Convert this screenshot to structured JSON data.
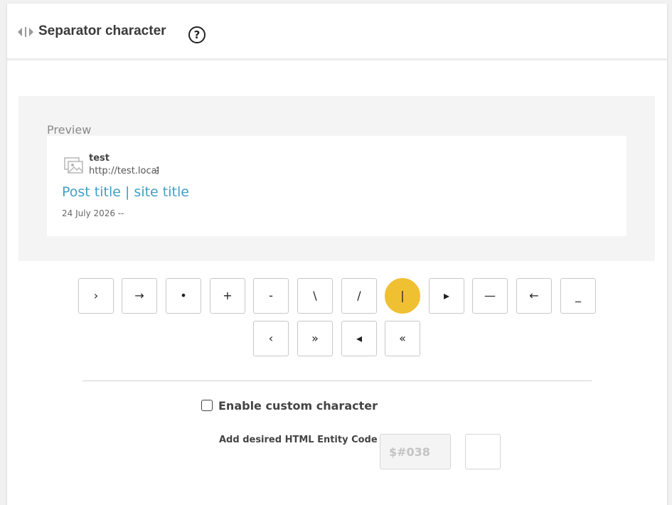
{
  "header": {
    "title": "Separator character",
    "help_icon": "?"
  },
  "preview": {
    "label": "Preview",
    "site_name": "test",
    "site_url": "http://test.local",
    "post_title": "Post title | site title",
    "date": "24 July 2026 --"
  },
  "separators": {
    "row1": [
      "›",
      "→",
      "•",
      "+",
      "-",
      "\\",
      "/",
      "|",
      "▸",
      "—",
      "←",
      "_"
    ],
    "row2": [
      "‹",
      "»",
      "◂",
      "«"
    ],
    "selected": "|"
  },
  "custom": {
    "enable_label": "Enable custom character",
    "enabled": false,
    "entity_label": "Add desired HTML Entity Code",
    "entity_placeholder": "$#038"
  },
  "colors": {
    "accent": "#f0c033",
    "link": "#3fa0c4"
  }
}
